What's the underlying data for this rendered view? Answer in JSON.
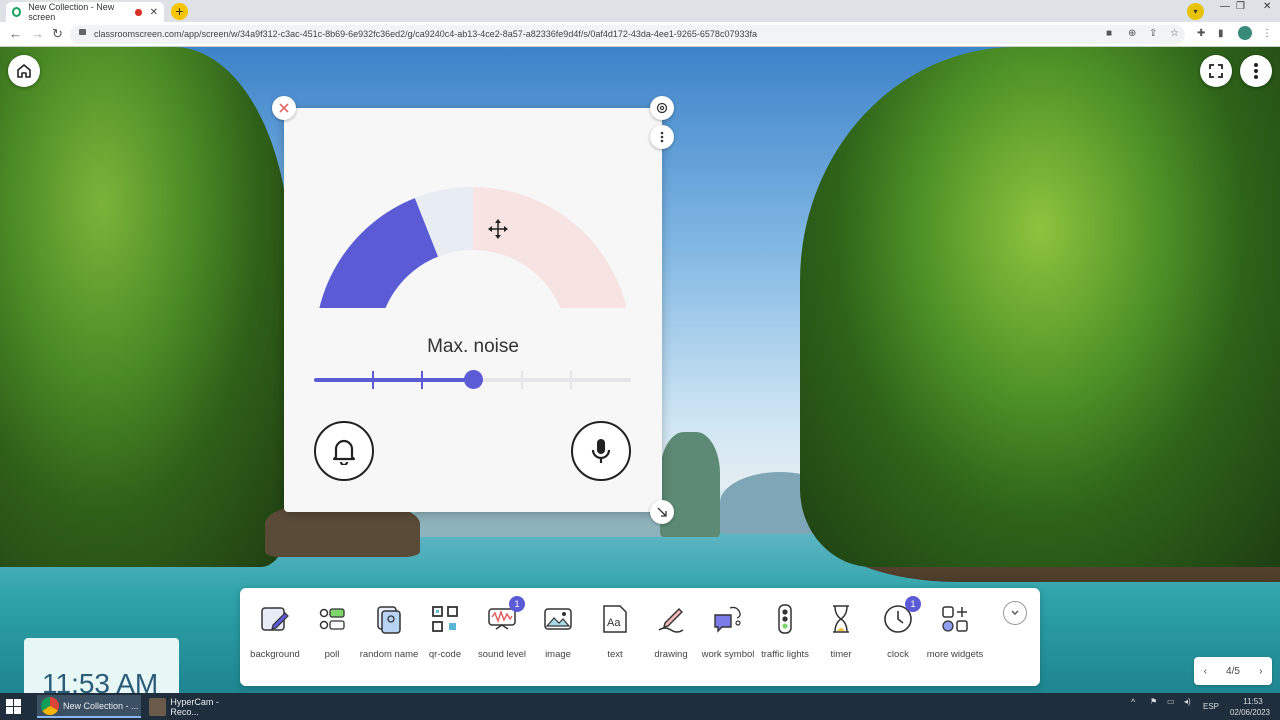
{
  "browser": {
    "tab_title": "New Collection - New screen",
    "new_tab_symbol": "+",
    "url": "classroomscreen.com/app/screen/w/34a9f312-c3ac-451c-8b69-6e932fc36ed2/g/ca9240c4-ab13-4ce2-8a57-a82336fe9d4f/s/0af4d172-43da-4ee1-9265-6578c07933fa"
  },
  "widget": {
    "name": "sound level",
    "max_noise_label": "Max. noise",
    "slider_level_percent": 50,
    "meter_level_percent": 38
  },
  "dock": {
    "items": [
      {
        "label": "background",
        "icon": "background-icon"
      },
      {
        "label": "poll",
        "icon": "poll-icon"
      },
      {
        "label": "random name",
        "icon": "random-name-icon"
      },
      {
        "label": "qr-code",
        "icon": "qr-code-icon"
      },
      {
        "label": "sound level",
        "icon": "sound-level-icon",
        "badge": "1"
      },
      {
        "label": "image",
        "icon": "image-icon"
      },
      {
        "label": "text",
        "icon": "text-icon"
      },
      {
        "label": "drawing",
        "icon": "drawing-icon"
      },
      {
        "label": "work symbol",
        "icon": "work-symbol-icon"
      },
      {
        "label": "traffic lights",
        "icon": "traffic-lights-icon"
      },
      {
        "label": "timer",
        "icon": "timer-icon"
      },
      {
        "label": "clock",
        "icon": "clock-icon",
        "badge": "1"
      },
      {
        "label": "more widgets",
        "icon": "more-widgets-icon"
      }
    ]
  },
  "clock": {
    "time": "11:53 AM"
  },
  "pager": {
    "label": "4/5"
  },
  "taskbar": {
    "chrome_task": "New Collection - ...",
    "hypercam_task": "HyperCam - Reco...",
    "language": "ESP",
    "time": "11:53",
    "date": "02/06/2023"
  },
  "colors": {
    "accent": "#5b5bd6",
    "meter_bg": "#e8ecf3",
    "meter_red": "#f7e4e2"
  }
}
